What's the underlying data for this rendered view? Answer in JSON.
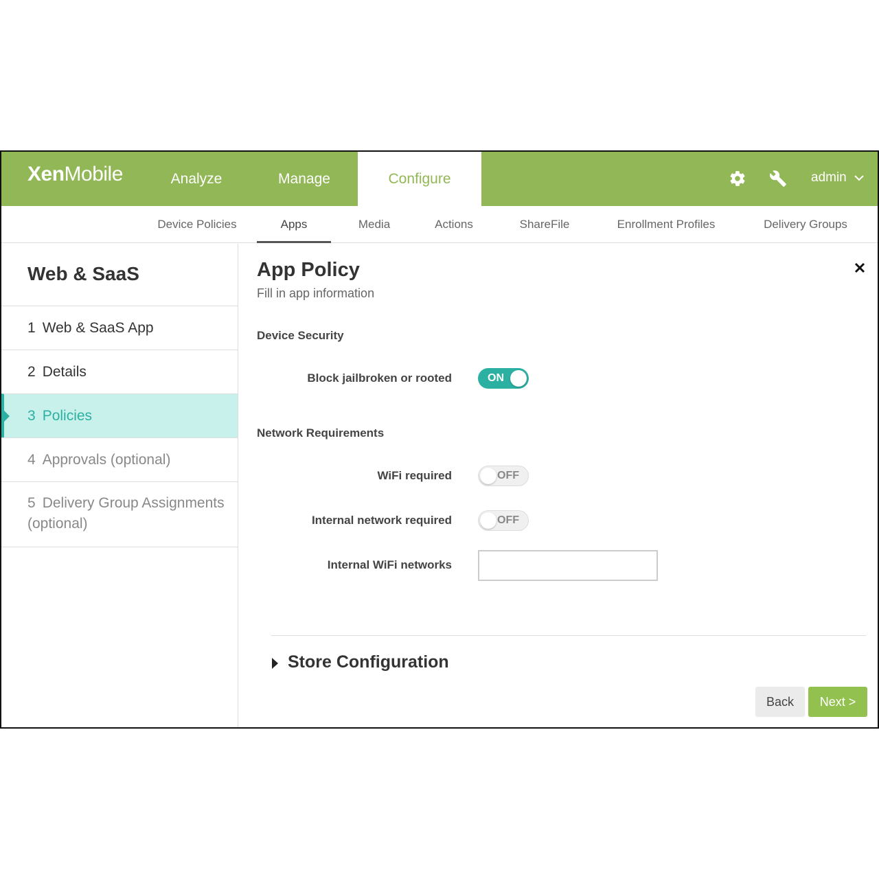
{
  "app": {
    "logo_bold": "Xen",
    "logo_thin": "Mobile"
  },
  "topnav": {
    "items": [
      "Analyze",
      "Manage",
      "Configure"
    ],
    "active": "Configure",
    "user": "admin",
    "icons": [
      "gear-icon",
      "wrench-icon",
      "chevron-down-icon"
    ]
  },
  "subnav": {
    "items": [
      "Device Policies",
      "Apps",
      "Media",
      "Actions",
      "ShareFile",
      "Enrollment Profiles",
      "Delivery Groups"
    ],
    "active": "Apps"
  },
  "sidebar": {
    "title": "Web & SaaS",
    "steps": [
      {
        "num": "1",
        "label": "Web & SaaS App"
      },
      {
        "num": "2",
        "label": "Details"
      },
      {
        "num": "3",
        "label": "Policies"
      },
      {
        "num": "4",
        "label": "Approvals (optional)"
      },
      {
        "num": "5",
        "label": "Delivery Group Assignments (optional)"
      }
    ],
    "active_step": "3"
  },
  "main": {
    "title": "App Policy",
    "subtitle": "Fill in app information",
    "device_security": {
      "heading": "Device Security",
      "block_jailbroken": {
        "label": "Block jailbroken or rooted",
        "state": "ON"
      }
    },
    "network": {
      "heading": "Network Requirements",
      "wifi_required": {
        "label": "WiFi required",
        "state": "OFF"
      },
      "internal_network": {
        "label": "Internal network required",
        "state": "OFF"
      },
      "internal_wifi": {
        "label": "Internal WiFi networks",
        "value": "",
        "placeholder": ""
      }
    },
    "store_config": "Store Configuration",
    "back_label": "Back",
    "next_label": "Next >"
  },
  "colors": {
    "brand_green": "#92b756",
    "accent_teal": "#2bb0a2",
    "active_step_bg": "#c9f1ec",
    "next_button": "#92c14f"
  }
}
